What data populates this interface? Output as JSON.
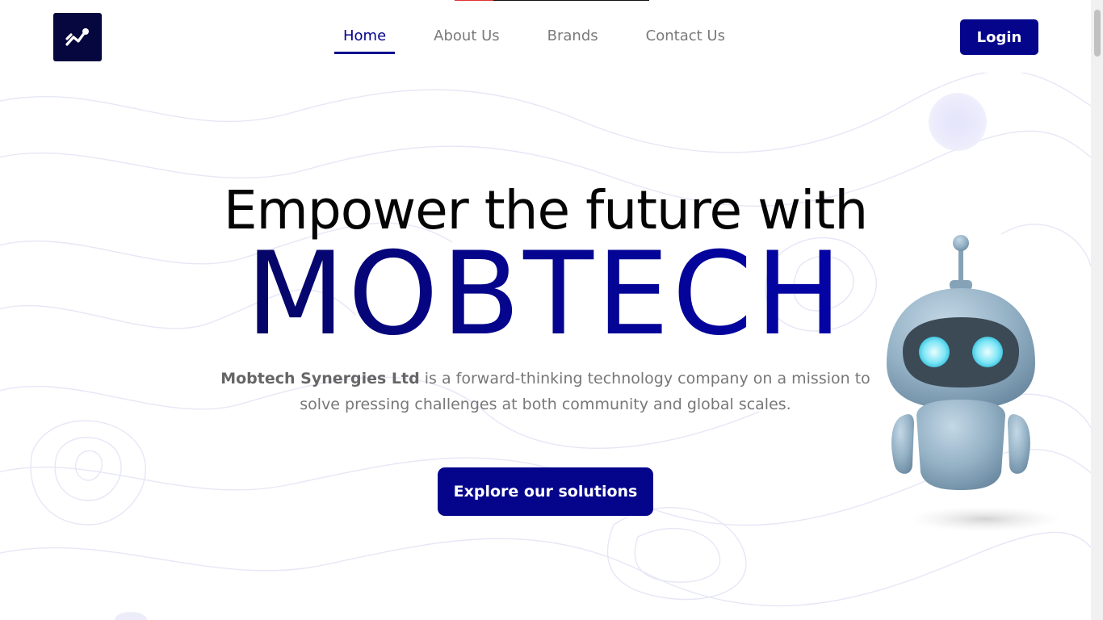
{
  "header": {
    "nav": [
      {
        "label": "Home",
        "active": true
      },
      {
        "label": "About Us",
        "active": false
      },
      {
        "label": "Brands",
        "active": false
      },
      {
        "label": "Contact Us",
        "active": false
      }
    ],
    "login_label": "Login"
  },
  "hero": {
    "headline": "Empower the future with",
    "brand": "MOBTECH",
    "company_name": "Mobtech Synergies Ltd",
    "description": " is a forward-thinking technology company on a mission to solve pressing challenges at both community and global scales.",
    "cta_label": "Explore our solutions"
  },
  "colors": {
    "primary": "#05058c",
    "logo_bg": "#07073f",
    "text_muted": "#777777"
  },
  "icons": {
    "logo": "trending-chart-icon",
    "mascot": "robot-mascot-icon"
  }
}
